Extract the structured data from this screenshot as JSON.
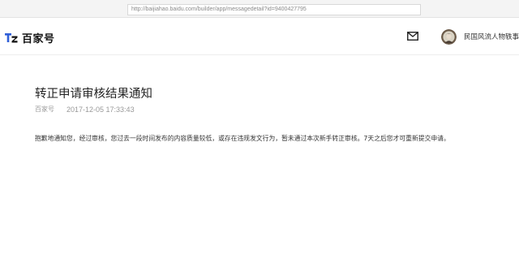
{
  "browser": {
    "url": "http://baijiahao.baidu.com/builder/app/messagedetail?id=9400427795"
  },
  "header": {
    "logo_text": "百家号",
    "mail_icon": "envelope-icon",
    "account_name": "民国风流人物轶事"
  },
  "article": {
    "title": "转正申请审核结果通知",
    "author": "百家号",
    "time": "2017-12-05 17:33:43",
    "body": "抱歉地通知您，经过审核，您过去一段时间发布的内容质量较低，或存在违规发文行为，暂未通过本次新手转正审核。7天之后您才可重新提交申请。"
  },
  "colors": {
    "logo_blue": "#2f5fd8",
    "text_dark": "#222222",
    "text_meta": "#999999"
  }
}
